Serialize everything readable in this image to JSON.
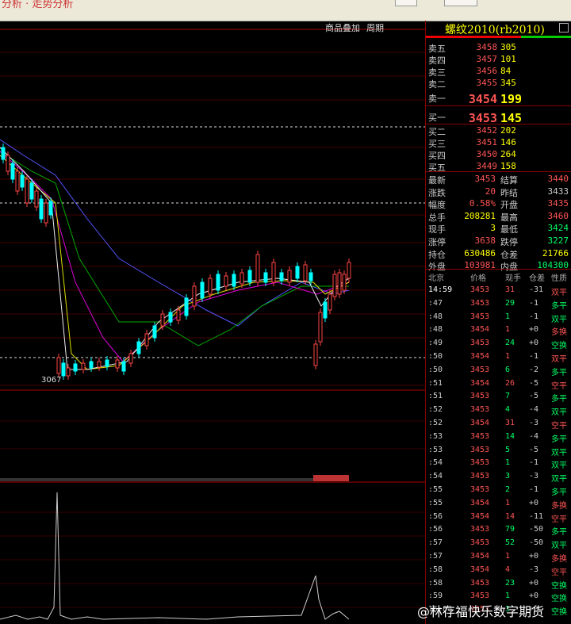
{
  "top_bar": {
    "title": "分析 · 走势分析"
  },
  "chart_toolbar": {
    "overlay_label": "商品叠加",
    "period_label": "周期"
  },
  "chart_annotation": {
    "low_label": "3067"
  },
  "colors": {
    "up": "#ff5555",
    "down": "#00ff66",
    "flat": "#cccccc",
    "yellow": "#ffff00",
    "cyan": "#00ffff"
  },
  "instrument": {
    "title": "螺纹2010(rb2010)"
  },
  "order_book": {
    "asks": [
      {
        "label": "卖五",
        "price": "3458",
        "vol": "305"
      },
      {
        "label": "卖四",
        "price": "3457",
        "vol": "101"
      },
      {
        "label": "卖三",
        "price": "3456",
        "vol": "84"
      },
      {
        "label": "卖二",
        "price": "3455",
        "vol": "345"
      },
      {
        "label": "卖一",
        "price": "3454",
        "vol": "199"
      }
    ],
    "bids": [
      {
        "label": "买一",
        "price": "3453",
        "vol": "145"
      },
      {
        "label": "买二",
        "price": "3452",
        "vol": "202"
      },
      {
        "label": "买三",
        "price": "3451",
        "vol": "146"
      },
      {
        "label": "买四",
        "price": "3450",
        "vol": "264"
      },
      {
        "label": "买五",
        "price": "3449",
        "vol": "158"
      }
    ]
  },
  "stats": [
    {
      "l1": "最新",
      "v1": "3453",
      "c1": "up",
      "l2": "结算",
      "v2": "3440",
      "c2": "up"
    },
    {
      "l1": "涨跌",
      "v1": "20",
      "c1": "up",
      "l2": "昨结",
      "v2": "3433",
      "c2": "flat"
    },
    {
      "l1": "幅度",
      "v1": "0.58%",
      "c1": "up",
      "l2": "开盘",
      "v2": "3435",
      "c2": "up"
    },
    {
      "l1": "总手",
      "v1": "208281",
      "c1": "yellow",
      "l2": "最高",
      "v2": "3460",
      "c2": "up"
    },
    {
      "l1": "现手",
      "v1": "3",
      "c1": "yellow",
      "l2": "最低",
      "v2": "3424",
      "c2": "down"
    },
    {
      "l1": "涨停",
      "v1": "3638",
      "c1": "up",
      "l2": "跌停",
      "v2": "3227",
      "c2": "down"
    },
    {
      "l1": "持仓",
      "v1": "630486",
      "c1": "yellow",
      "l2": "仓差",
      "v2": "21766",
      "c2": "yellow"
    },
    {
      "l1": "外盘",
      "v1": "103981",
      "c1": "up",
      "l2": "内盘",
      "v2": "104300",
      "c2": "down"
    }
  ],
  "ticks_header": {
    "time": "北京",
    "price": "价格",
    "vol": "现手",
    "oi": "仓差",
    "nature": "性质"
  },
  "ticks": [
    {
      "time": "14:59",
      "price": "3453",
      "vol": "31",
      "oi": "-31",
      "nature": "双平",
      "pc": "up",
      "nc": "up"
    },
    {
      "time": ":47",
      "price": "3453",
      "vol": "29",
      "oi": "-1",
      "nature": "多平",
      "pc": "up",
      "nc": "down"
    },
    {
      "time": ":48",
      "price": "3453",
      "vol": "1",
      "oi": "-1",
      "nature": "双平",
      "pc": "up",
      "nc": "down"
    },
    {
      "time": ":48",
      "price": "3454",
      "vol": "1",
      "oi": "+0",
      "nature": "多换",
      "pc": "up",
      "nc": "up"
    },
    {
      "time": ":49",
      "price": "3453",
      "vol": "24",
      "oi": "+0",
      "nature": "空换",
      "pc": "up",
      "nc": "down"
    },
    {
      "time": ":50",
      "price": "3454",
      "vol": "1",
      "oi": "-1",
      "nature": "双平",
      "pc": "up",
      "nc": "up"
    },
    {
      "time": ":50",
      "price": "3453",
      "vol": "6",
      "oi": "-2",
      "nature": "多平",
      "pc": "up",
      "nc": "down"
    },
    {
      "time": ":51",
      "price": "3454",
      "vol": "26",
      "oi": "-5",
      "nature": "空平",
      "pc": "up",
      "nc": "up"
    },
    {
      "time": ":51",
      "price": "3453",
      "vol": "7",
      "oi": "-5",
      "nature": "多平",
      "pc": "up",
      "nc": "down"
    },
    {
      "time": ":52",
      "price": "3453",
      "vol": "4",
      "oi": "-4",
      "nature": "双平",
      "pc": "up",
      "nc": "down"
    },
    {
      "time": ":52",
      "price": "3454",
      "vol": "31",
      "oi": "-3",
      "nature": "空平",
      "pc": "up",
      "nc": "up"
    },
    {
      "time": ":53",
      "price": "3453",
      "vol": "14",
      "oi": "-4",
      "nature": "多平",
      "pc": "up",
      "nc": "down"
    },
    {
      "time": ":53",
      "price": "3453",
      "vol": "5",
      "oi": "-5",
      "nature": "双平",
      "pc": "up",
      "nc": "down"
    },
    {
      "time": ":54",
      "price": "3453",
      "vol": "1",
      "oi": "-1",
      "nature": "双平",
      "pc": "up",
      "nc": "down"
    },
    {
      "time": ":54",
      "price": "3453",
      "vol": "3",
      "oi": "-3",
      "nature": "双平",
      "pc": "up",
      "nc": "down"
    },
    {
      "time": ":55",
      "price": "3453",
      "vol": "2",
      "oi": "-1",
      "nature": "多平",
      "pc": "up",
      "nc": "down"
    },
    {
      "time": ":55",
      "price": "3454",
      "vol": "1",
      "oi": "+0",
      "nature": "多换",
      "pc": "up",
      "nc": "up"
    },
    {
      "time": ":56",
      "price": "3454",
      "vol": "14",
      "oi": "-11",
      "nature": "空平",
      "pc": "up",
      "nc": "up"
    },
    {
      "time": ":56",
      "price": "3453",
      "vol": "79",
      "oi": "-50",
      "nature": "多平",
      "pc": "up",
      "nc": "down"
    },
    {
      "time": ":57",
      "price": "3453",
      "vol": "52",
      "oi": "-50",
      "nature": "双平",
      "pc": "up",
      "nc": "down"
    },
    {
      "time": ":57",
      "price": "3454",
      "vol": "1",
      "oi": "+0",
      "nature": "多换",
      "pc": "up",
      "nc": "up"
    },
    {
      "time": ":58",
      "price": "3454",
      "vol": "4",
      "oi": "-3",
      "nature": "空平",
      "pc": "up",
      "nc": "up"
    },
    {
      "time": ":58",
      "price": "3453",
      "vol": "23",
      "oi": "+0",
      "nature": "空换",
      "pc": "up",
      "nc": "down"
    },
    {
      "time": ":59",
      "price": "3453",
      "vol": "1",
      "oi": "+0",
      "nature": "空换",
      "pc": "up",
      "nc": "down"
    },
    {
      "time": "15:00",
      "price": "3453",
      "vol": "3",
      "oi": "+0",
      "nature": "空换",
      "pc": "up",
      "nc": "down"
    }
  ],
  "watermark": "@林存福快乐数字期货"
}
